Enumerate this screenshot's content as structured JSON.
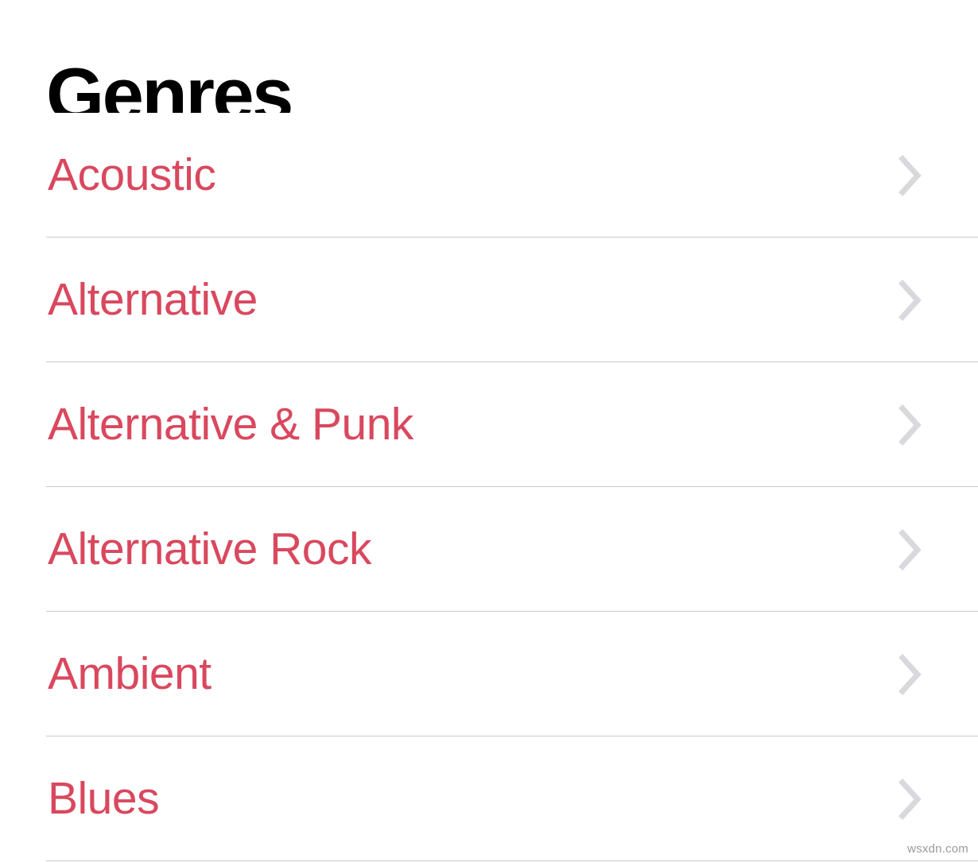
{
  "page": {
    "title": "Genres",
    "background_color": "#ffffff",
    "accent_color": "#d9485e",
    "divider_color": "#c9c9ce",
    "chevron_color": "#d8d8dd",
    "title_color": "#000000"
  },
  "list": {
    "items": [
      {
        "label": "Acoustic",
        "disclosure_icon": "chevron-right-icon"
      },
      {
        "label": "Alternative",
        "disclosure_icon": "chevron-right-icon"
      },
      {
        "label": "Alternative & Punk",
        "disclosure_icon": "chevron-right-icon"
      },
      {
        "label": "Alternative Rock",
        "disclosure_icon": "chevron-right-icon"
      },
      {
        "label": "Ambient",
        "disclosure_icon": "chevron-right-icon"
      },
      {
        "label": "Blues",
        "disclosure_icon": "chevron-right-icon"
      }
    ]
  },
  "watermark": {
    "text": "wsxdn.com"
  }
}
